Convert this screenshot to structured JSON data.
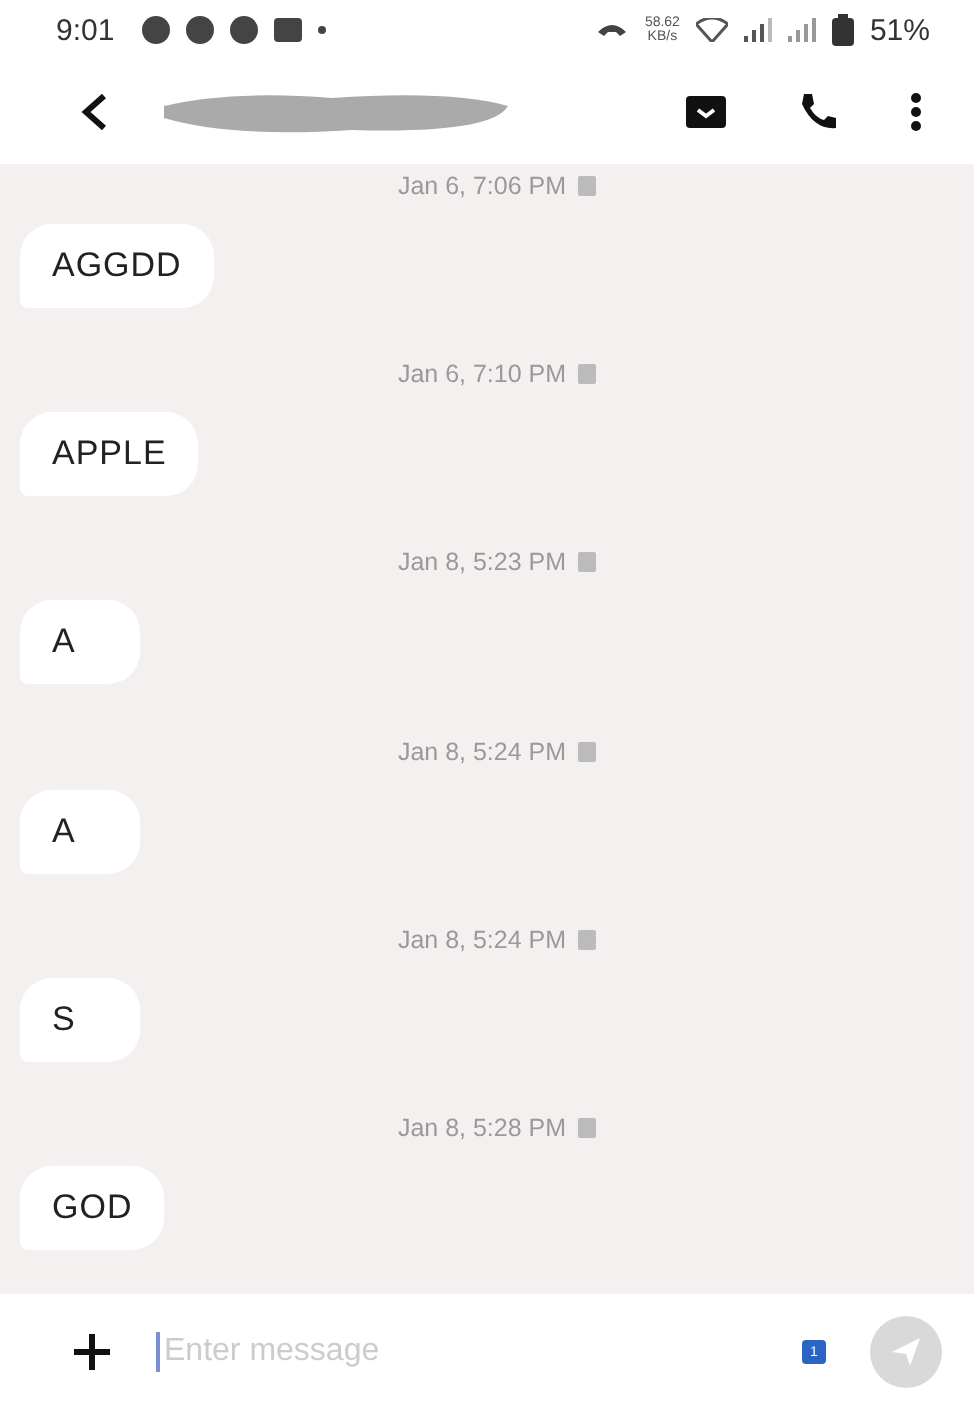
{
  "status_bar": {
    "time": "9:01",
    "speed_value": "58.62",
    "speed_unit": "KB/s",
    "battery": "51%"
  },
  "messages": [
    {
      "time": "Jan 6, 7:06 PM",
      "text": "AGGDD"
    },
    {
      "time": "Jan 6, 7:10 PM",
      "text": "APPLE"
    },
    {
      "time": "Jan 8, 5:23 PM",
      "text": "A"
    },
    {
      "time": "Jan 8, 5:24 PM",
      "text": "A"
    },
    {
      "time": "Jan 8, 5:24 PM",
      "text": "S"
    },
    {
      "time": "Jan 8, 5:28 PM",
      "text": "GOD"
    }
  ],
  "composer": {
    "placeholder": "Enter message",
    "sim_badge": "1"
  }
}
